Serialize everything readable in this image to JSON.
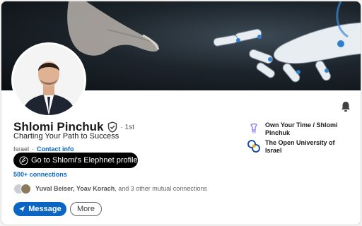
{
  "profile": {
    "name": "Shlomi Pinchuk",
    "degree": "· 1st",
    "headline": "Charting Your Path to Success",
    "location": "Israel",
    "location_separator": "·",
    "contact_info": "Contact info",
    "connections": "500+ connections"
  },
  "elephnet_button": {
    "label": "Go to Shlomi's Elephnet profile"
  },
  "mutual": {
    "name1": "Yuval Beiser",
    "separator": ", ",
    "name2": "Yoav Korach",
    "rest": ", and 3 other mutual connections"
  },
  "actions": {
    "message_label": "Message",
    "more_label": "More"
  },
  "affiliations": [
    {
      "name": "Own Your Time / Shlomi Pinchuk",
      "icon": "own-your-time-logo"
    },
    {
      "name": "The Open University of Israel",
      "icon": "open-university-logo"
    }
  ],
  "colors": {
    "accent": "#0a66c2",
    "dark_button": "#000000"
  }
}
